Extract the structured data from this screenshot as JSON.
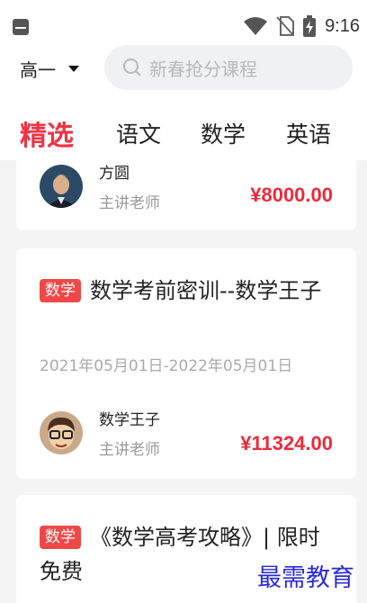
{
  "status_bar": {
    "time": "9:16"
  },
  "header": {
    "grade": "高一",
    "search_placeholder": "新春抢分课程"
  },
  "tabs": [
    {
      "label": "精选",
      "active": true
    },
    {
      "label": "语文",
      "active": false
    },
    {
      "label": "数学",
      "active": false
    },
    {
      "label": "英语",
      "active": false
    }
  ],
  "courses": [
    {
      "teacher_name": "方圆",
      "teacher_role": "主讲老师",
      "price": "¥8000.00"
    },
    {
      "tag": "数学",
      "title": "数学考前密训--数学王子",
      "date_range": "2021年05月01日-2022年05月01日",
      "teacher_name": "数学王子",
      "teacher_role": "主讲老师",
      "price": "¥11324.00"
    },
    {
      "tag": "数学",
      "title": "《数学高考攻略》| 限时免费"
    }
  ],
  "watermark": "最需教育",
  "colors": {
    "accent": "#ee3344",
    "tag": "#f04848",
    "price": "#ee2a3a"
  }
}
